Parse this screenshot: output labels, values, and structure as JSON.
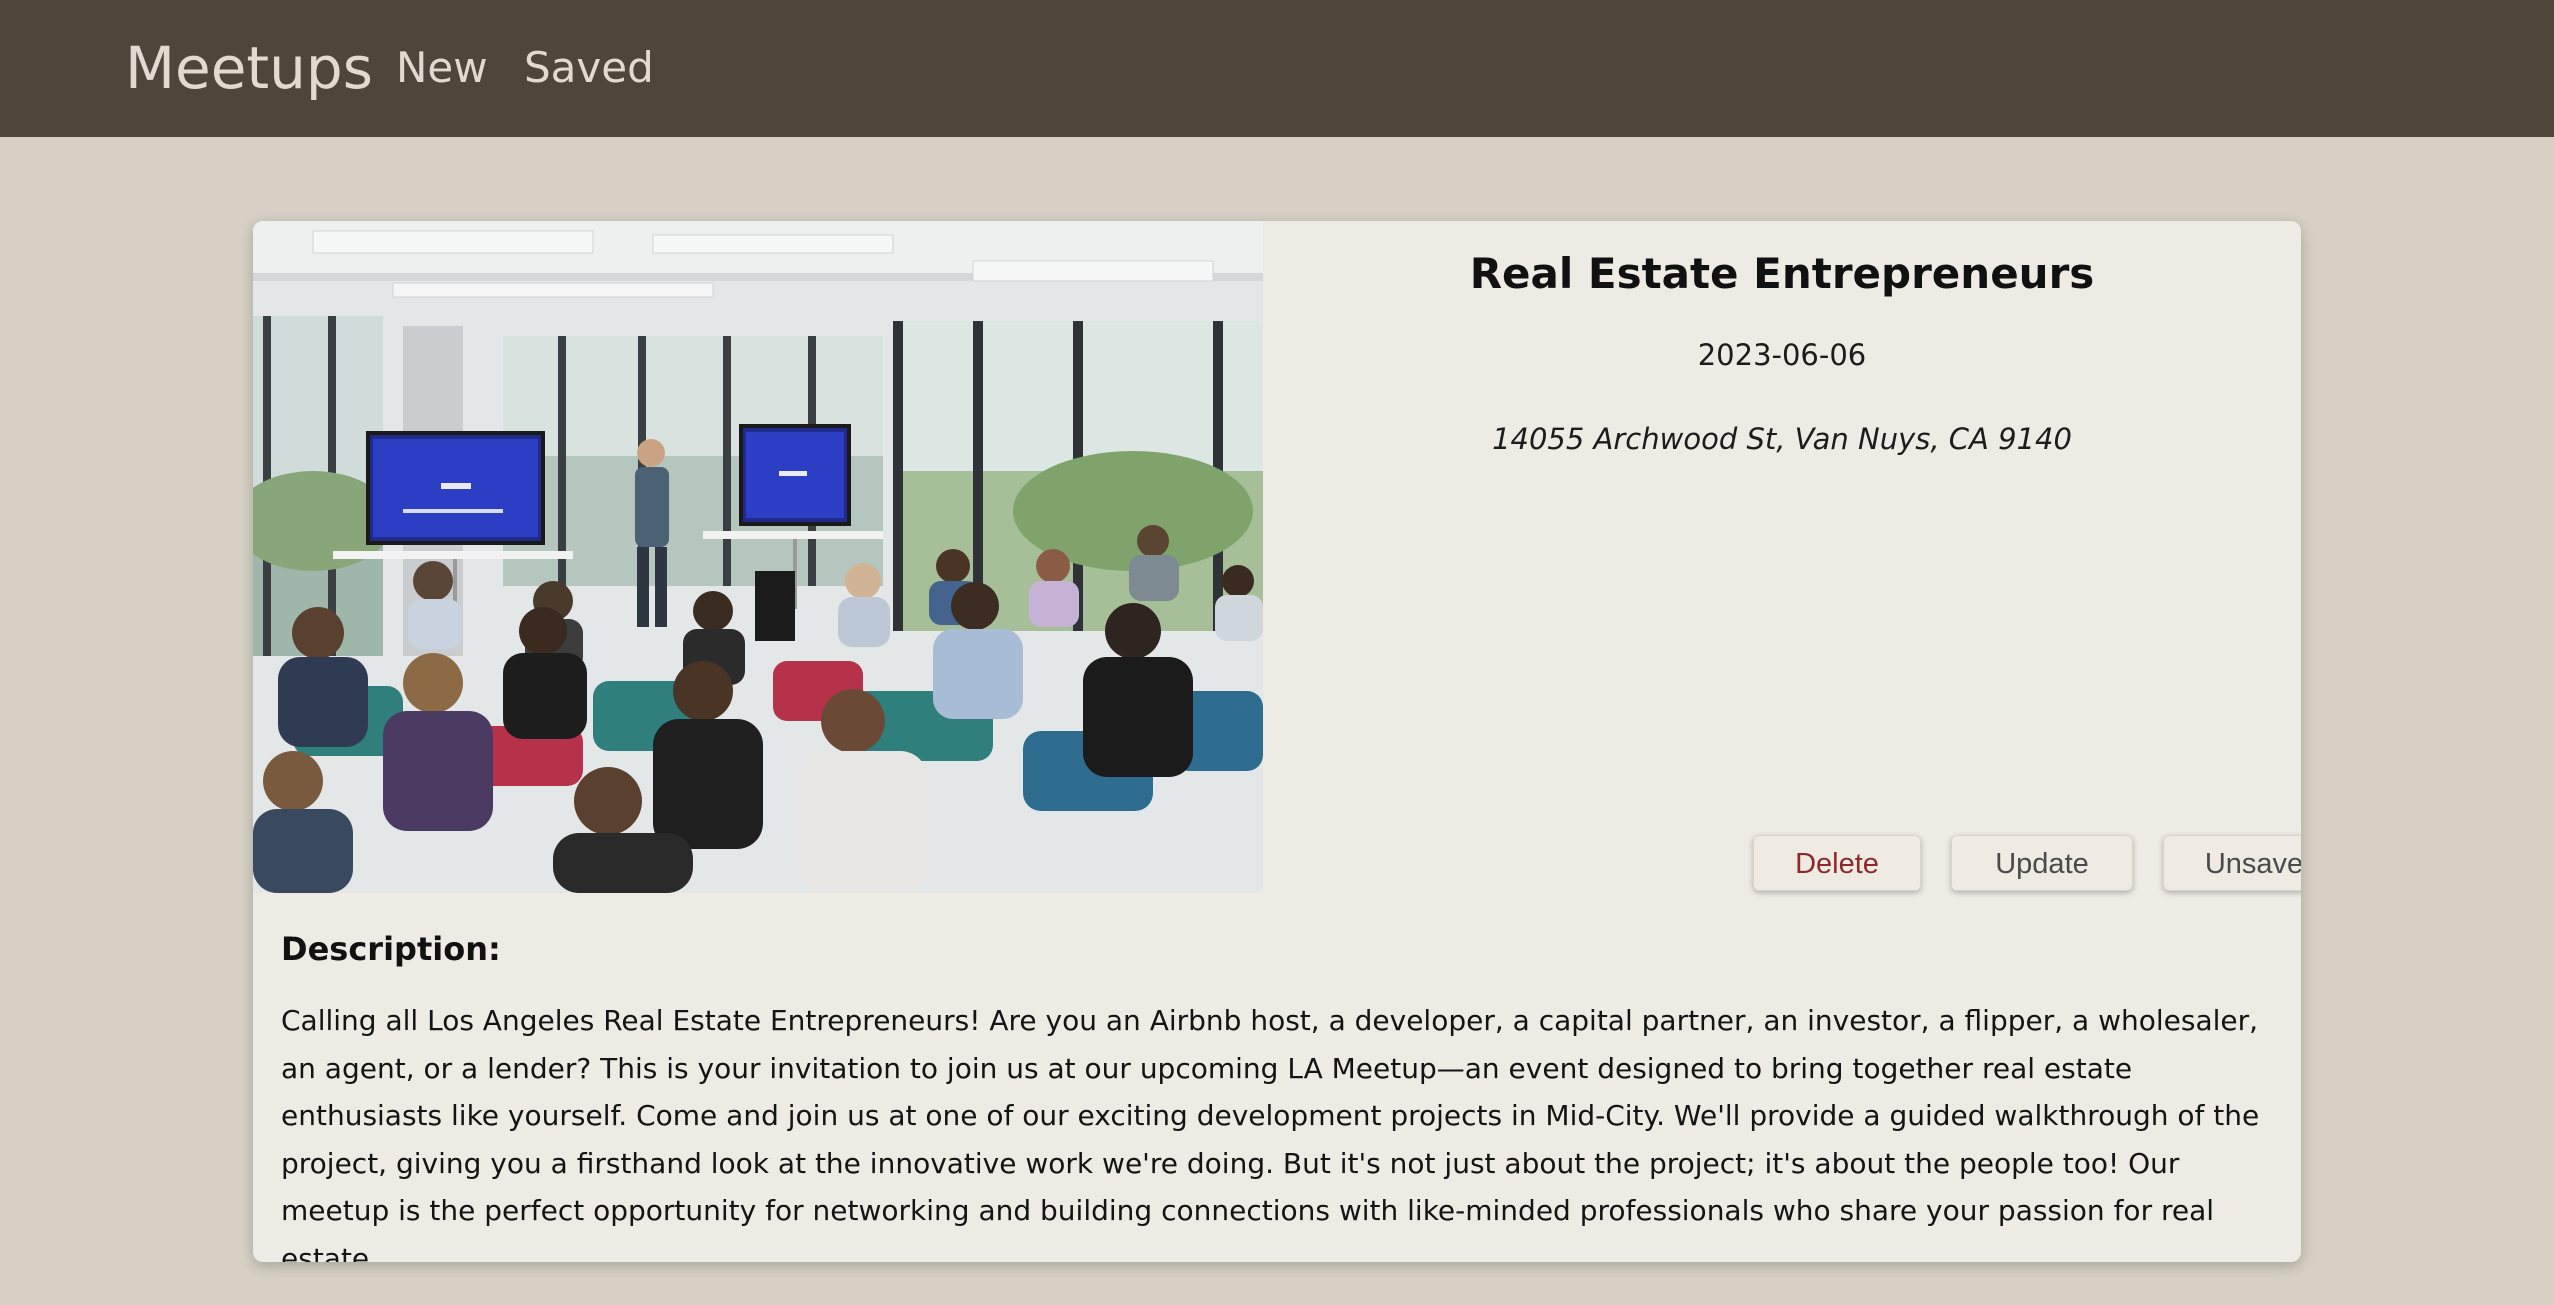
{
  "nav": {
    "brand": "Meetups",
    "links": [
      "New",
      "Saved"
    ]
  },
  "meetup": {
    "title": "Real Estate Entrepreneurs",
    "date": "2023-06-06",
    "address": "14055 Archwood St, Van Nuys, CA 9140",
    "image_alt": "Audience seated in a bright meeting room watching a presenter standing between two screens",
    "description_heading": "Description:",
    "description": "Calling all Los Angeles Real Estate Entrepreneurs! Are you an Airbnb host, a developer, a capital partner, an investor, a flipper, a wholesaler, an agent, or a lender? This is your invitation to join us at our upcoming LA Meetup—an event designed to bring together real estate enthusiasts like yourself. Come and join us at one of our exciting development projects in Mid-City. We'll provide a guided walkthrough of the project, giving you a firsthand look at the innovative work we're doing. But it's not just about the project; it's about the people too! Our meetup is the perfect opportunity for networking and building connections with like-minded professionals who share your passion for real estate."
  },
  "actions": {
    "delete_label": "Delete",
    "update_label": "Update",
    "unsave_label": "Unsave"
  },
  "colors": {
    "navbar": "#4d463a",
    "page_background": "#d6d1c4",
    "card_background": "#eeebe4",
    "delete_text": "#8b2a2a"
  }
}
